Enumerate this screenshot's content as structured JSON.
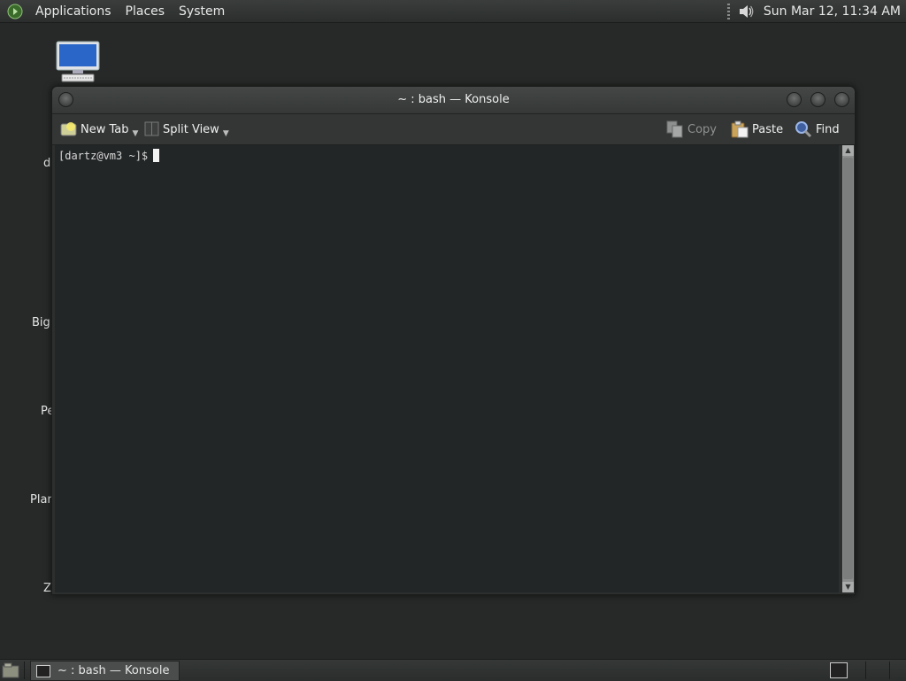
{
  "top_panel": {
    "menus": [
      "Applications",
      "Places",
      "System"
    ],
    "clock": "Sun Mar 12, 11:34 AM",
    "icons": [
      "gnome-foot-icon",
      "volume-icon"
    ]
  },
  "desktop": {
    "labels": [
      "d",
      "Big",
      "Pe",
      "Plan",
      "Z"
    ]
  },
  "window": {
    "title": "~ : bash — Konsole",
    "toolbar": {
      "new_tab": "New Tab",
      "split_view": "Split View",
      "copy": "Copy",
      "paste": "Paste",
      "find": "Find"
    },
    "terminal": {
      "prompt": "[dartz@vm3 ~]$"
    }
  },
  "taskbar": {
    "tasks": [
      {
        "label": "~ : bash — Konsole"
      }
    ]
  },
  "colors": {
    "background": "#262928",
    "terminal_bg": "#232627",
    "panel": "#2b2e2d"
  }
}
